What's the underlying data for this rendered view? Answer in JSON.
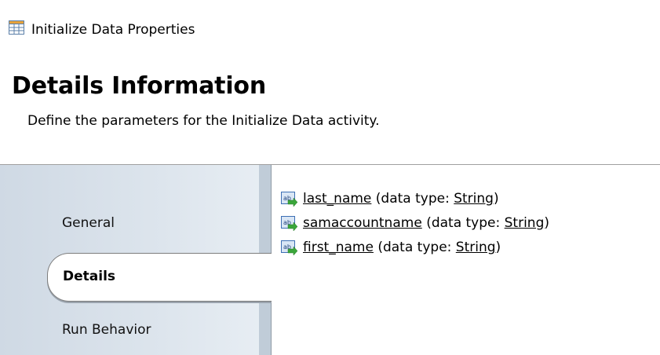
{
  "window": {
    "title": "Initialize Data Properties",
    "icon": "table-icon"
  },
  "header": {
    "title": "Details Information",
    "subtitle": "Define the parameters for the Initialize Data activity."
  },
  "tabs": [
    {
      "label": "General",
      "selected": false
    },
    {
      "label": "Details",
      "selected": true
    },
    {
      "label": "Run Behavior",
      "selected": false
    }
  ],
  "parameters": [
    {
      "name": "last_name",
      "type_prefix": "(data type: ",
      "type": "String",
      "type_suffix": ")",
      "icon": "string-parameter-icon"
    },
    {
      "name": "samaccountname",
      "type_prefix": "(data type: ",
      "type": "String",
      "type_suffix": ")",
      "icon": "string-parameter-icon"
    },
    {
      "name": "first_name",
      "type_prefix": "(data type: ",
      "type": "String",
      "type_suffix": ")",
      "icon": "string-parameter-icon"
    }
  ],
  "colors": {
    "accent_green": "#3aa63a",
    "icon_blue": "#3d6fb4",
    "sidebar": "#d6dfe8"
  }
}
